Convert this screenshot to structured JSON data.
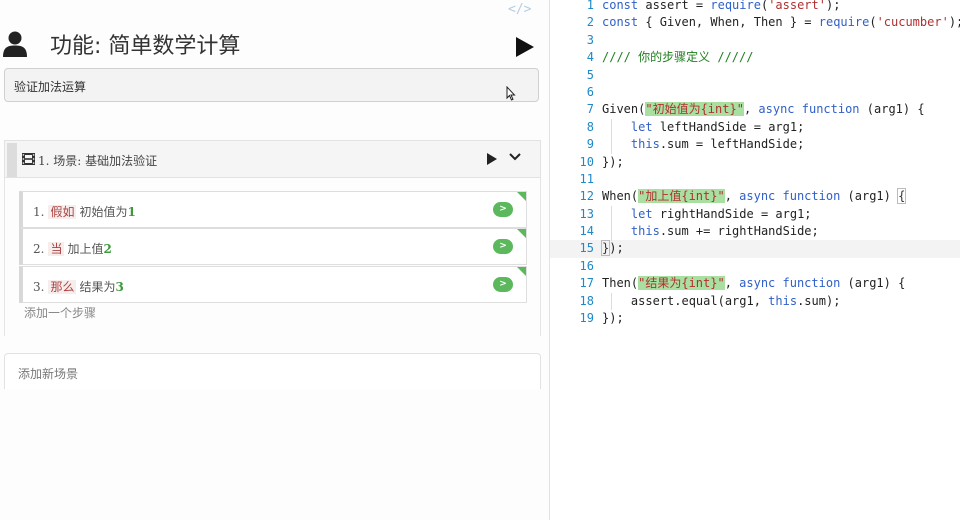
{
  "editor": {
    "code_toggle_icon": "</>",
    "user_icon": "user-icon",
    "feature_title": "功能: 简单数学计算",
    "description": "验证加法运算",
    "scenario": {
      "title": "1. 场景: 基础加法验证",
      "steps": [
        {
          "number": "1.",
          "keyword": "假如",
          "text": "初始值为",
          "param": "1",
          "run_label": ">"
        },
        {
          "number": "2.",
          "keyword": "当",
          "text": "加上值",
          "param": "2",
          "run_label": ">"
        },
        {
          "number": "3.",
          "keyword": "那么",
          "text": "结果为",
          "param": "3",
          "run_label": ">"
        }
      ],
      "add_step_label": "添加一个步骤"
    },
    "add_scenario_label": "添加新场景",
    "colors": {
      "passed": "#5cb85c",
      "keyword": "#a94442",
      "param": "#3c9a3c"
    }
  },
  "code_lines": [
    {
      "n": "1",
      "tokens": [
        {
          "t": "const",
          "c": "kwd"
        },
        {
          "t": " assert = "
        },
        {
          "t": "require",
          "c": "kwd"
        },
        {
          "t": "("
        },
        {
          "t": "'assert'",
          "c": "str"
        },
        {
          "t": ");"
        }
      ]
    },
    {
      "n": "2",
      "tokens": [
        {
          "t": "const",
          "c": "kwd"
        },
        {
          "t": " { Given, When, Then } = "
        },
        {
          "t": "require",
          "c": "kwd"
        },
        {
          "t": "("
        },
        {
          "t": "'cucumber'",
          "c": "str"
        },
        {
          "t": ");"
        }
      ]
    },
    {
      "n": "3",
      "tokens": []
    },
    {
      "n": "4",
      "tokens": [
        {
          "t": "//// 你的步骤定义 /////",
          "c": "cmt"
        }
      ]
    },
    {
      "n": "5",
      "tokens": []
    },
    {
      "n": "6",
      "tokens": []
    },
    {
      "n": "7",
      "tokens": [
        {
          "t": "Given("
        },
        {
          "t": "\"初始值为{int}\"",
          "c": "strhi"
        },
        {
          "t": ", "
        },
        {
          "t": "async function",
          "c": "kwd"
        },
        {
          "t": " (arg1) {"
        }
      ]
    },
    {
      "n": "8",
      "tokens": [
        {
          "t": "    "
        },
        {
          "t": "let",
          "c": "kwd"
        },
        {
          "t": " leftHandSide = arg1;"
        }
      ]
    },
    {
      "n": "9",
      "tokens": [
        {
          "t": "    "
        },
        {
          "t": "this",
          "c": "kwd"
        },
        {
          "t": ".sum = leftHandSide;"
        }
      ]
    },
    {
      "n": "10",
      "tokens": [
        {
          "t": "});"
        }
      ]
    },
    {
      "n": "11",
      "tokens": []
    },
    {
      "n": "12",
      "tokens": [
        {
          "t": "When("
        },
        {
          "t": "\"加上值{int}\"",
          "c": "strhi"
        },
        {
          "t": ", "
        },
        {
          "t": "async function",
          "c": "kwd"
        },
        {
          "t": " (arg1) "
        },
        {
          "t": "{",
          "c": "bracehi"
        }
      ]
    },
    {
      "n": "13",
      "tokens": [
        {
          "t": "    "
        },
        {
          "t": "let",
          "c": "kwd"
        },
        {
          "t": " rightHandSide = arg1;"
        }
      ]
    },
    {
      "n": "14",
      "tokens": [
        {
          "t": "    "
        },
        {
          "t": "this",
          "c": "kwd"
        },
        {
          "t": ".sum += rightHandSide;"
        }
      ]
    },
    {
      "n": "15",
      "tokens": [
        {
          "t": "}",
          "c": "bracehi"
        },
        {
          "t": ");"
        }
      ]
    },
    {
      "n": "16",
      "tokens": []
    },
    {
      "n": "17",
      "tokens": [
        {
          "t": "Then("
        },
        {
          "t": "\"结果为{int}\"",
          "c": "strhi"
        },
        {
          "t": ", "
        },
        {
          "t": "async function",
          "c": "kwd"
        },
        {
          "t": " (arg1) {"
        }
      ]
    },
    {
      "n": "18",
      "tokens": [
        {
          "t": "    assert.equal(arg1, "
        },
        {
          "t": "this",
          "c": "kwd"
        },
        {
          "t": ".sum);"
        }
      ]
    },
    {
      "n": "19",
      "tokens": [
        {
          "t": "});"
        }
      ]
    }
  ]
}
